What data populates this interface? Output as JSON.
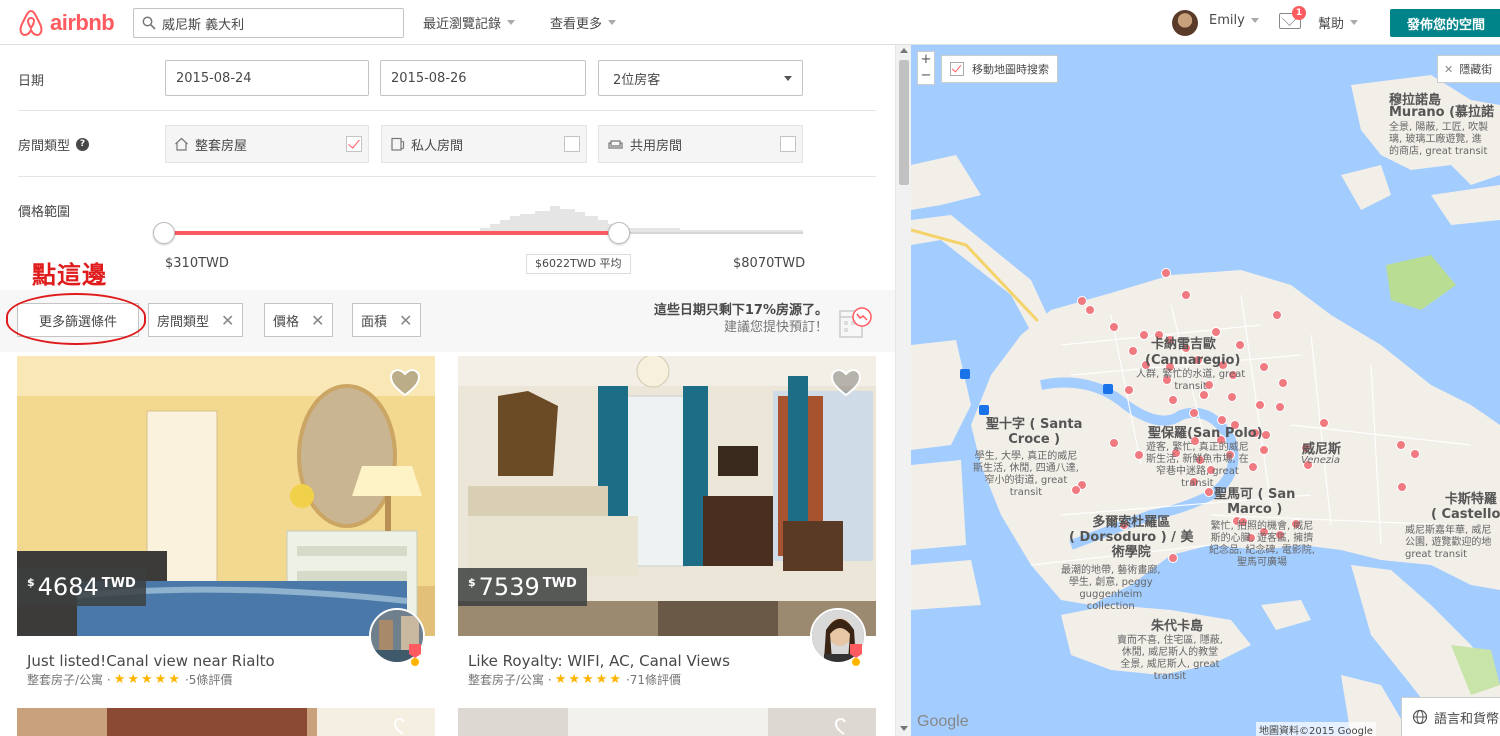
{
  "header": {
    "logo_text": "airbnb",
    "search_value": "威尼斯 義大利",
    "recent": "最近瀏覽記錄",
    "more": "查看更多",
    "user_name": "Emily",
    "mail_count": "1",
    "help": "幫助",
    "host_button": "發佈您的空間"
  },
  "filters": {
    "date_label": "日期",
    "checkin": "2015-08-24",
    "checkout": "2015-08-26",
    "guests": "2位房客",
    "room_type_label": "房間類型",
    "help_glyph": "?",
    "room_types": [
      {
        "label": "整套房屋",
        "checked": true
      },
      {
        "label": "私人房間",
        "checked": false
      },
      {
        "label": "共用房間",
        "checked": false
      }
    ],
    "price_label": "價格範圍",
    "price_min": "$310TWD",
    "price_max": "$8070TWD",
    "price_avg": "$6022TWD 平均"
  },
  "annotation": {
    "text": "點這邊"
  },
  "filter_chips": {
    "more_filters": "更多篩選條件",
    "chips": [
      "房間類型",
      "價格",
      "面積"
    ],
    "remove_glyph": "✕"
  },
  "availability": {
    "line1": "這些日期只剩下17%房源了。",
    "line2": "建議您提快預訂！"
  },
  "listings": [
    {
      "price_currency_symbol": "$",
      "price": "4684",
      "price_unit": "TWD",
      "title": "Just listed!Canal view near Rialto",
      "type": "整套房子/公寓 ·",
      "stars": "★★★★★",
      "reviews": "·5條評價"
    },
    {
      "price_currency_symbol": "$",
      "price": "7539",
      "price_unit": "TWD",
      "title": "Like Royalty: WIFI, AC, Canal Views",
      "type": "整套房子/公寓 ·",
      "stars": "★★★★★",
      "reviews": "·71條評價"
    }
  ],
  "map": {
    "zoom_in": "+",
    "zoom_out": "−",
    "move_search": "移動地圖時搜索",
    "hide": "隱藏街",
    "hide_glyph": "✕",
    "lang": "語言和貨幣",
    "credit": "地圖資料©2015 Google",
    "google": "Google",
    "labels": {
      "murano": "Murano (慕拉諾",
      "murano_cn": "穆拉諾島",
      "murano_desc": "全景, 陽蔽, 工匠, 吹製\n璃, 玻璃工廠遊覽, 進\n的商店, great transit",
      "cannaregio_cn": "卡納雷吉歐",
      "cannaregio": "(Cannaregio)",
      "cannaregio_desc": "人群, 繁忙的水道, great\ntransit",
      "santacroce": "聖十字 ( Santa\nCroce )",
      "santacroce_desc": "學生, 大學, 真正的威尼\n斯生活, 休閒, 四通八達,\n窄小的街道, great\ntransit",
      "sanpolo": "聖保羅(San Polo)",
      "sanpolo_desc": "遊客, 繁忙, 真正的威尼\n斯生活, 新鮮魚市場, 在\n窄巷中迷路, great\ntransit",
      "venezia_cn": "威尼斯",
      "venezia": "Venezia",
      "sanmarco": "聖馬可 ( San\nMarco )",
      "sanmarco_desc": "繁忙, 拍照的機會, 威尼\n斯的心臟, 遊客區, 擁擠\n紀念品, 紀念碑, 電影院,\n聖馬可廣場",
      "dorsoduro": "多爾索杜羅區\n( Dorsoduro ) / 美\n術學院",
      "dorsoduro_desc": "最潮的地帶, 藝術畫廊,\n學生, 創意, peggy\nguggenheim\ncollection",
      "castello": "卡斯特羅\n( Castello )",
      "castello_desc": "威尼斯嘉年華, 威尼\n公園, 遊覽歡迎的地\ngreat transit",
      "giudecca": "朱代卡島",
      "giudecca_desc": "賣而不喜, 住宅區, 隱蔽,\n休閒, 威尼斯人的教堂\n全景, 威尼斯人, great\ntransit"
    }
  },
  "colors": {
    "brand": "#ff5a5f",
    "teal": "#008489",
    "water": "#a3ccff",
    "land": "#f2efe9",
    "park": "#b9dd93",
    "annotation": "#e01b1b"
  }
}
